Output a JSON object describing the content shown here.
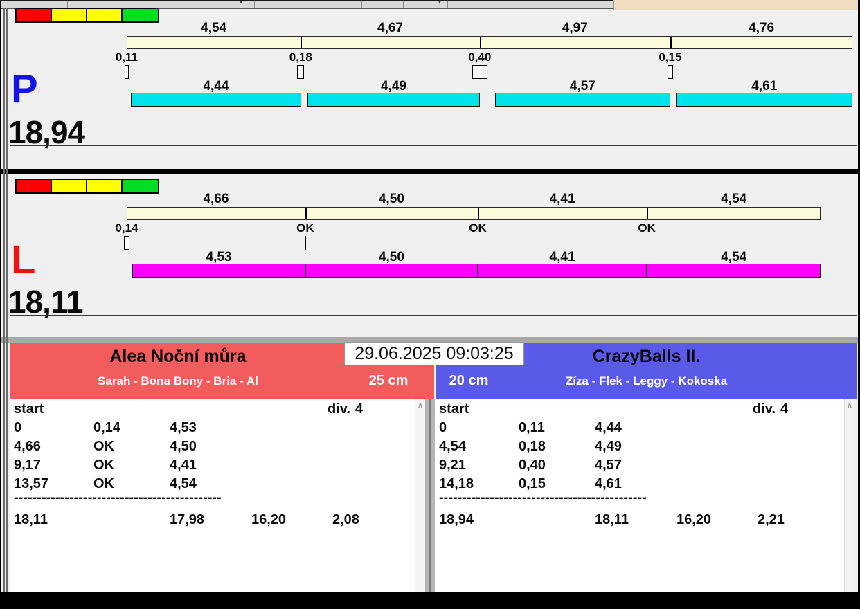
{
  "window": {
    "timestamp": "29.06.2025 09:03:25",
    "icons": {
      "scroll_up": "∧",
      "toolbar_chevron": "˅"
    }
  },
  "lanes": [
    {
      "label": "P",
      "label_color": "#1414e8",
      "total": "18,94",
      "total_value": 18.94,
      "traffic_lights": [
        "#ff0000",
        "#ffff00",
        "#ffff00",
        "#00dd22"
      ],
      "split_bar_color": "#fcfcdd",
      "dog_bar_color": "#00e2ec",
      "splits": [
        "4,54",
        "4,67",
        "4,97",
        "4,76"
      ],
      "split_values": [
        4.54,
        4.67,
        4.97,
        4.76
      ],
      "changeovers": [
        "0,11",
        "0,18",
        "0,40",
        "0,15"
      ],
      "changeover_values": [
        0.11,
        0.18,
        0.4,
        0.15
      ],
      "dog_times": [
        "4,44",
        "4,49",
        "4,57",
        "4,61"
      ],
      "dog_values": [
        4.44,
        4.49,
        4.57,
        4.61
      ]
    },
    {
      "label": "L",
      "label_color": "#ee1111",
      "total": "18,11",
      "total_value": 18.11,
      "traffic_lights": [
        "#ff0000",
        "#ffff00",
        "#ffff00",
        "#00dd22"
      ],
      "split_bar_color": "#fcfcdd",
      "dog_bar_color": "#ff00ff",
      "splits": [
        "4,66",
        "4,50",
        "4,41",
        "4,54"
      ],
      "split_values": [
        4.66,
        4.5,
        4.41,
        4.54
      ],
      "changeovers": [
        "0,14",
        "OK",
        "OK",
        "OK"
      ],
      "changeover_values": [
        0.14,
        0,
        0,
        0
      ],
      "dog_times": [
        "4,53",
        "4,50",
        "4,41",
        "4,54"
      ],
      "dog_values": [
        4.53,
        4.5,
        4.41,
        4.54
      ]
    }
  ],
  "teams": [
    {
      "name": "Alea Noční můra",
      "members": "Sarah - Bona Bony - Bria - Al",
      "jump_height": "25 cm",
      "header_color": "#f25c5c",
      "table": {
        "start_label": "start",
        "div_label": "div.",
        "div_value": "4",
        "rows": [
          [
            "0",
            "0,14",
            "4,53"
          ],
          [
            "4,66",
            "OK",
            "4,50"
          ],
          [
            "9,17",
            "OK",
            "4,41"
          ],
          [
            "13,57",
            "OK",
            "4,54"
          ]
        ],
        "separator": "---------------------------------------------",
        "totals": [
          "18,11",
          "17,98",
          "16,20",
          "2,08"
        ]
      }
    },
    {
      "name": "CrazyBalls II.",
      "members": "Zíza - Flek - Leggy - Kokoska",
      "jump_height": "20 cm",
      "header_color": "#5a5ae8",
      "table": {
        "start_label": "start",
        "div_label": "div.",
        "div_value": "4",
        "rows": [
          [
            "0",
            "0,11",
            "4,44"
          ],
          [
            "4,54",
            "0,18",
            "4,49"
          ],
          [
            "9,21",
            "0,40",
            "4,57"
          ],
          [
            "14,18",
            "0,15",
            "4,61"
          ]
        ],
        "separator": "---------------------------------------------",
        "totals": [
          "18,94",
          "18,11",
          "16,20",
          "2,21"
        ]
      }
    }
  ]
}
